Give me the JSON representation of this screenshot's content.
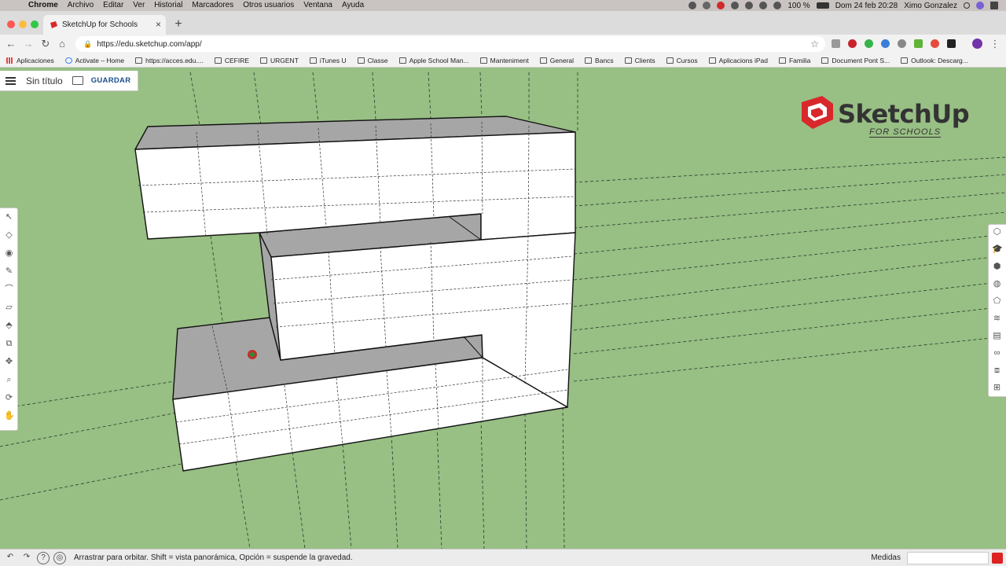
{
  "menubar": {
    "app": "Chrome",
    "items": [
      "Archivo",
      "Editar",
      "Ver",
      "Historial",
      "Marcadores",
      "Otros usuarios",
      "Ventana",
      "Ayuda"
    ],
    "battery": "100 %",
    "datetime": "Dom 24 feb  20:28",
    "user": "Ximo Gonzalez"
  },
  "browser": {
    "tab_title": "SketchUp for Schools",
    "url": "https://edu.sketchup.com/app/",
    "bookmarks": [
      "Aplicaciones",
      "Activate – Home",
      "https://acces.edu....",
      "CEFIRE",
      "URGENT",
      "iTunes U",
      "Classe",
      "Apple School Man...",
      "Manteniment",
      "General",
      "Bancs",
      "Clients",
      "Cursos",
      "Aplicacions iPad",
      "Familia",
      "Document Pont S...",
      "Outlook: Descarg..."
    ]
  },
  "app": {
    "doc_title": "Sin título",
    "save_label": "GUARDAR",
    "logo_word": "SketchUp",
    "logo_sub": "FOR SCHOOLS",
    "status_text": "Arrastrar para orbitar. Shift = vista panorámica, Opción = suspende la gravedad.",
    "measure_label": "Medidas",
    "measure_value": ""
  },
  "colors": {
    "viewport_bg": "#98bf84",
    "face_white": "#ffffff",
    "face_gray": "#a6a6a6",
    "brand_red": "#d8282c",
    "save_blue": "#1b4e8a"
  },
  "icons": {
    "left_toolbar": [
      "select-icon",
      "eraser-icon",
      "paint-bucket-icon",
      "pencil-icon",
      "arc-icon",
      "rectangle-icon",
      "push-pull-icon",
      "offset-icon",
      "move-icon",
      "tape-measure-icon",
      "orbit-icon",
      "pan-icon"
    ],
    "right_toolbar": [
      "entity-info-icon",
      "instructor-icon",
      "components-icon",
      "materials-icon",
      "styles-icon",
      "tags-icon",
      "scenes-icon",
      "display-icon",
      "shadows-icon",
      "outliner-icon"
    ]
  }
}
